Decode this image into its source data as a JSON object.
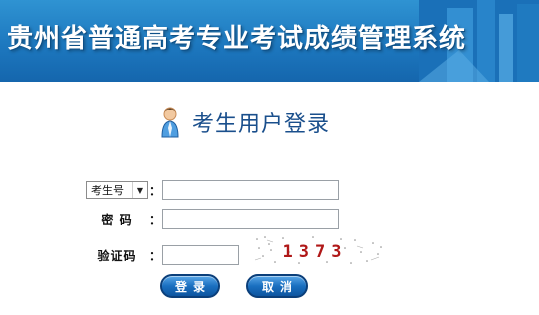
{
  "banner": {
    "title": "贵州省普通高考专业考试成绩管理系统"
  },
  "login": {
    "title": "考生用户登录"
  },
  "form": {
    "account_type": {
      "selected": "考生号",
      "options": [
        "考生号"
      ]
    },
    "colon": "：",
    "password_label": "密 码",
    "captcha_label": "验证码",
    "captcha_text": "1373",
    "account_value": "",
    "password_value": "",
    "captcha_value": ""
  },
  "buttons": {
    "login_label": "登录",
    "cancel_label": "取消"
  },
  "colors": {
    "banner_blue": "#1d78bf",
    "title_blue": "#1a4f8c",
    "button_blue": "#1a6fc0",
    "captcha_red": "#b01818"
  },
  "icons": {
    "user": "user-icon",
    "dropdown": "chevron-down-icon"
  }
}
